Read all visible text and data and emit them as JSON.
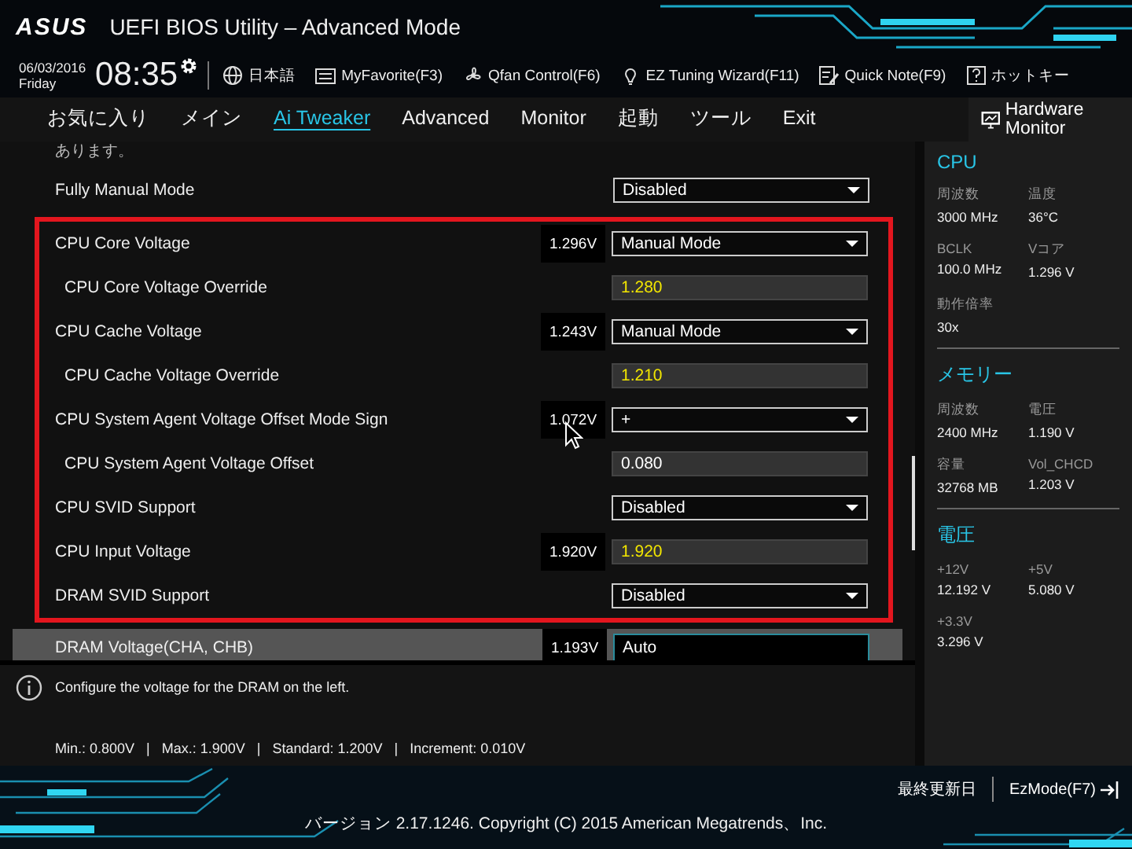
{
  "header": {
    "logo": "ASUS",
    "title": "UEFI BIOS Utility – Advanced Mode"
  },
  "toolbar": {
    "date": "06/03/2016",
    "day": "Friday",
    "time": "08:35",
    "items": [
      {
        "kind": "language",
        "label": "日本語"
      },
      {
        "kind": "favorite",
        "label": "MyFavorite(F3)"
      },
      {
        "kind": "fan",
        "label": "Qfan Control(F6)"
      },
      {
        "kind": "tuning",
        "label": "EZ Tuning Wizard(F11)"
      },
      {
        "kind": "note",
        "label": "Quick Note(F9)"
      },
      {
        "kind": "hotkey",
        "label": "ホットキー"
      }
    ]
  },
  "tabs": [
    {
      "label": "お気に入り",
      "selected": false
    },
    {
      "label": "メイン",
      "selected": false
    },
    {
      "label": "Ai Tweaker",
      "selected": true
    },
    {
      "label": "Advanced",
      "selected": false
    },
    {
      "label": "Monitor",
      "selected": false
    },
    {
      "label": "起動",
      "selected": false
    },
    {
      "label": "ツール",
      "selected": false
    },
    {
      "label": "Exit",
      "selected": false
    }
  ],
  "settings": {
    "cut_text": "あります。",
    "rows_before": [
      {
        "label": "Fully Manual Mode",
        "kind": "dropdown",
        "value": "Disabled",
        "selected": false
      }
    ],
    "marked_rows": [
      {
        "label": "CPU Core Voltage",
        "reading": "1.296V",
        "kind": "dropdown",
        "value": "Manual Mode",
        "selected": false,
        "children": [
          {
            "label": "CPU Core Voltage Override",
            "kind": "input",
            "value": "1.280",
            "modified": true,
            "selected": false
          }
        ]
      },
      {
        "label": "CPU Cache Voltage",
        "reading": "1.243V",
        "kind": "dropdown",
        "value": "Manual Mode",
        "selected": false,
        "children": [
          {
            "label": "CPU Cache Voltage Override",
            "kind": "input",
            "value": "1.210",
            "modified": true,
            "selected": false
          }
        ]
      },
      {
        "label": "CPU System Agent Voltage Offset Mode Sign",
        "reading": "1.072V",
        "kind": "dropdown",
        "value": "+",
        "selected": false,
        "children": [
          {
            "label": "CPU System Agent Voltage Offset",
            "kind": "input",
            "value": "0.080",
            "modified": false,
            "selected": false
          }
        ]
      },
      {
        "label": "CPU SVID Support",
        "kind": "dropdown",
        "value": "Disabled",
        "selected": false
      },
      {
        "label": "CPU Input Voltage",
        "reading": "1.920V",
        "kind": "input",
        "value": "1.920",
        "modified": true,
        "selected": false
      },
      {
        "label": "DRAM SVID Support",
        "kind": "dropdown",
        "value": "Disabled",
        "selected": false
      }
    ],
    "rows_after": [
      {
        "label": "DRAM Voltage(CHA, CHB)",
        "reading": "1.193V",
        "kind": "input",
        "value": "Auto",
        "modified": false,
        "selected": true
      }
    ]
  },
  "help": {
    "text": "Configure the voltage for the DRAM on the left.",
    "limits": "Min.: 0.800V   |   Max.: 1.900V   |   Standard: 1.200V   |   Increment: 0.010V"
  },
  "hardware_monitor": {
    "title": "Hardware Monitor",
    "sections": [
      {
        "title": "CPU",
        "items": [
          {
            "label": "周波数",
            "value": "3000 MHz"
          },
          {
            "label": "温度",
            "value": "36°C"
          },
          {
            "label": "BCLK",
            "value": "100.0 MHz"
          },
          {
            "label": "Vコア",
            "value": "1.296 V"
          },
          {
            "label": "動作倍率",
            "value": "30x"
          }
        ]
      },
      {
        "title": "メモリー",
        "items": [
          {
            "label": "周波数",
            "value": "2400 MHz"
          },
          {
            "label": "電圧",
            "value": "1.190 V"
          },
          {
            "label": "容量",
            "value": "32768 MB"
          },
          {
            "label": "Vol_CHCD",
            "value": "1.203 V"
          }
        ]
      },
      {
        "title": "電圧",
        "items": [
          {
            "label": "+12V",
            "value": "12.192 V"
          },
          {
            "label": "+5V",
            "value": "5.080 V"
          },
          {
            "label": "+3.3V",
            "value": "3.296 V"
          }
        ]
      }
    ]
  },
  "footer": {
    "last_modified": "最終更新日",
    "ez_mode": "EzMode(F7)",
    "version": "バージョン 2.17.1246. Copyright (C) 2015 American Megatrends、Inc."
  }
}
